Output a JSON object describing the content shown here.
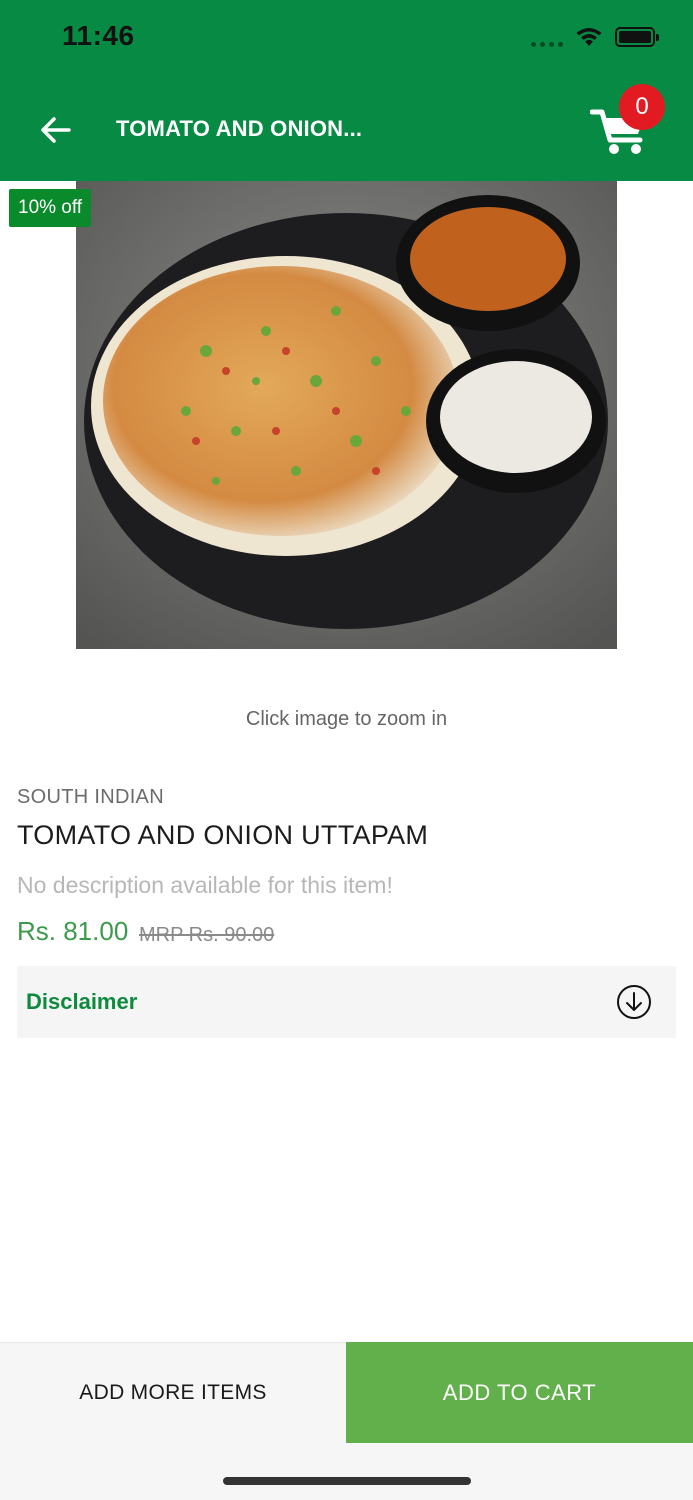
{
  "status_bar": {
    "time": "11:46"
  },
  "header": {
    "title": "TOMATO AND ONION...",
    "cart_count": "0",
    "back_icon": "arrow-left-icon",
    "cart_icon": "cart-icon",
    "background": "#078a43"
  },
  "product": {
    "discount_badge": "10% off",
    "zoom_hint": "Click image to zoom in",
    "category": "SOUTH INDIAN",
    "name": "TOMATO AND ONION UTTAPAM",
    "description": "No description available for this item!",
    "price": "Rs. 81.00",
    "mrp": "MRP Rs. 90.00"
  },
  "disclaimer": {
    "label": "Disclaimer",
    "icon": "arrow-down-circle-icon"
  },
  "footer": {
    "add_more_label": "ADD MORE ITEMS",
    "add_to_cart_label": "ADD TO CART",
    "add_to_cart_color": "#62b04b"
  }
}
